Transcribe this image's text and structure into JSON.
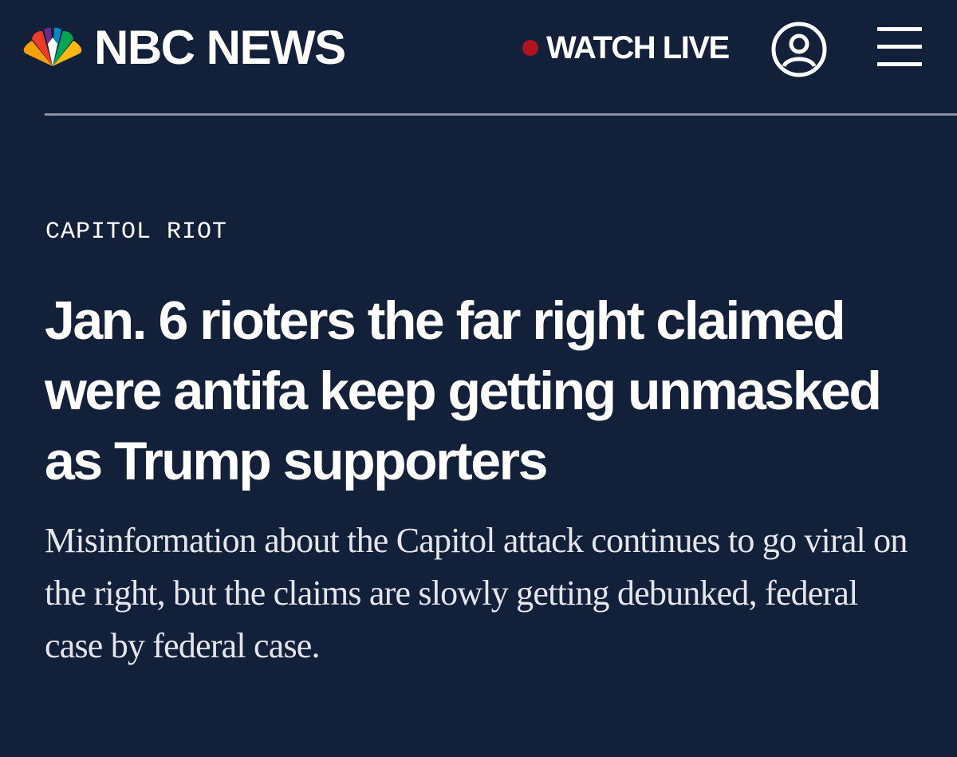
{
  "header": {
    "brand": "NBC NEWS",
    "watch_live_label": "WATCH LIVE",
    "colors": {
      "background": "#13203a",
      "live_dot": "#b0141f",
      "peacock": [
        "#f5a300",
        "#ef3b24",
        "#6c2b87",
        "#0089cf",
        "#00a650",
        "#fcb711"
      ]
    },
    "icons": {
      "logo": "nbc-peacock-icon",
      "account": "account-icon",
      "menu": "hamburger-menu-icon"
    }
  },
  "article": {
    "category": "CAPITOL RIOT",
    "headline": "Jan. 6 rioters the far right claimed were antifa keep getting unmasked as Trump supporters",
    "dek": "Misinformation about the Capitol attack continues to go viral on the right, but the claims are slowly getting debunked, federal case by federal case."
  }
}
